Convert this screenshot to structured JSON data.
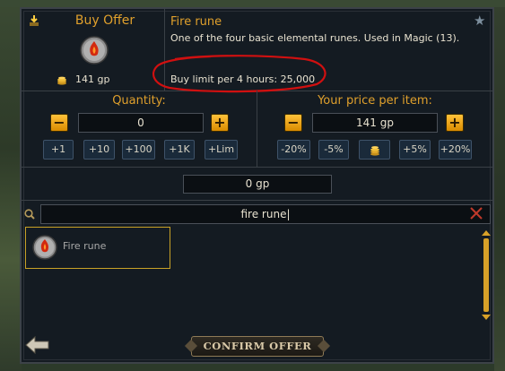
{
  "offer": {
    "title": "Buy Offer",
    "item_price": "141 gp"
  },
  "item": {
    "name": "Fire rune",
    "description": "One of the four basic elemental runes. Used in Magic (13).",
    "buy_limit": "Buy limit per 4 hours: 25,000"
  },
  "quantity": {
    "label": "Quantity:",
    "value": "0",
    "minus": "−",
    "plus": "+",
    "buttons": [
      "+1",
      "+10",
      "+100",
      "+1K",
      "+Lim"
    ]
  },
  "price": {
    "label": "Your price per item:",
    "value": "141 gp",
    "minus": "−",
    "plus": "+",
    "buttons": [
      "-20%",
      "-5%",
      "",
      "+5%",
      "+20%"
    ]
  },
  "total": "0 gp",
  "search": {
    "value": "fire rune|"
  },
  "results": [
    {
      "name": "Fire rune"
    }
  ],
  "confirm_label": "CONFIRM OFFER",
  "colors": {
    "gold": "#e0a02c",
    "highlight_border": "#c9a227",
    "annotation_red": "#d01010"
  },
  "icons": [
    "offer-arrow-icon",
    "fire-rune-icon",
    "coins-icon",
    "star-icon",
    "search-icon",
    "clear-icon",
    "back-arrow-icon",
    "coin-stack-icon"
  ]
}
